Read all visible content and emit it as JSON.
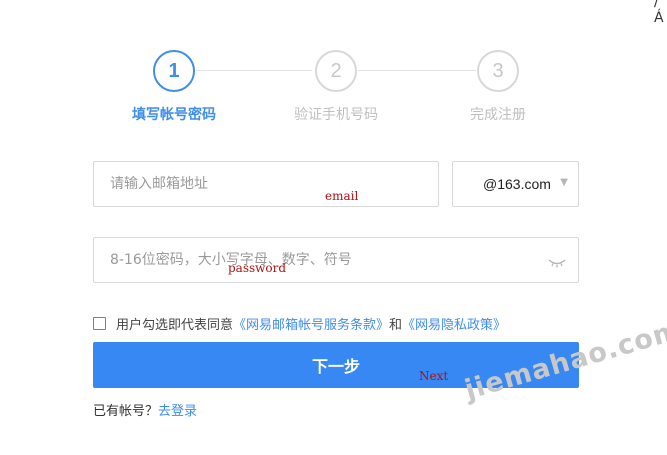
{
  "corner_glyph": "/Á",
  "steps": [
    {
      "number": "1",
      "label": "填写帐号密码",
      "active": true
    },
    {
      "number": "2",
      "label": "验证手机号码",
      "active": false
    },
    {
      "number": "3",
      "label": "完成注册",
      "active": false
    }
  ],
  "email": {
    "placeholder": "请输入邮箱地址",
    "value": "",
    "annotation": "email"
  },
  "domain_select": {
    "selected": "@163.com",
    "caret": "▼"
  },
  "password": {
    "placeholder": "8-16位密码，大小写字母、数字、符号",
    "value": "",
    "annotation": "password",
    "toggle_icon": "eye-closed-icon"
  },
  "agreement": {
    "checked": false,
    "prefix": "用户勾选即代表同意",
    "link1": "《网易邮箱帐号服务条款》",
    "conjunction": "和",
    "link2": "《网易隐私政策》"
  },
  "next_button": {
    "label": "下一步",
    "annotation": "Next"
  },
  "login": {
    "prompt": "已有帐号？",
    "link": "去登录"
  },
  "watermark": "jiemahao.com",
  "colors": {
    "accent": "#3f8ee8",
    "button": "#3788f2",
    "annotation": "#b01010"
  }
}
